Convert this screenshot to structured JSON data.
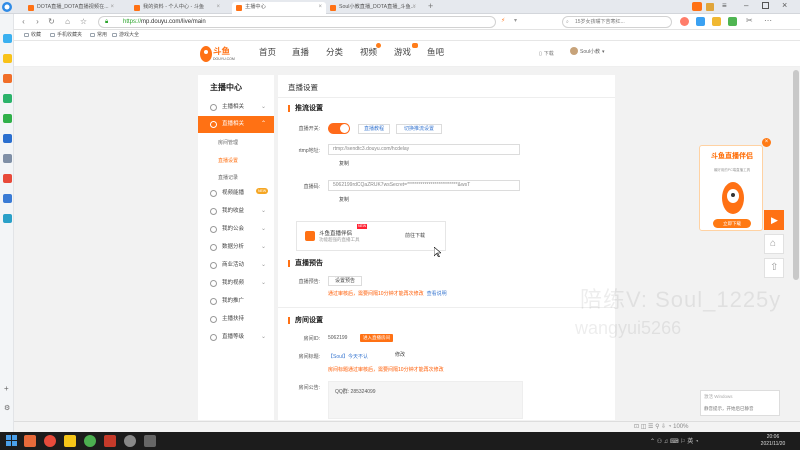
{
  "browser": {
    "tabs": [
      {
        "label": "DOTA直播_DOTA直播视频在..."
      },
      {
        "label": "我的资料 - 个人中心 - 斗鱼"
      },
      {
        "label": "主播中心"
      },
      {
        "label": "Soul小教直播_DOTA直播_斗鱼..."
      }
    ],
    "url_prefix": "https://",
    "url_rest": "mp.douyu.com/live/main",
    "search_placeholder": "15岁女孩嘴下苦寒红...",
    "bookmarks": [
      "收藏",
      "手机收藏夹",
      "常用",
      "游戏大全"
    ]
  },
  "site": {
    "logo_text": "斗鱼",
    "logo_sub": "DOUYU.COM",
    "nav": [
      "首页",
      "直播",
      "分类",
      "视频",
      "游戏",
      "鱼吧"
    ],
    "download": "下载",
    "user": "Soul小教"
  },
  "sidebar": {
    "title": "主播中心",
    "items": [
      {
        "label": "主播相关"
      },
      {
        "label": "直播相关"
      },
      {
        "label": "视频能播"
      },
      {
        "label": "我的收益"
      },
      {
        "label": "我的公会"
      },
      {
        "label": "数据分析"
      },
      {
        "label": "商业活动"
      },
      {
        "label": "我的视频"
      },
      {
        "label": "我的推广"
      },
      {
        "label": "主播扶持"
      },
      {
        "label": "直播等级"
      }
    ],
    "sub_items": [
      "房间管理",
      "直播设置",
      "直播记录"
    ]
  },
  "main": {
    "title": "直播设置",
    "push_section": "推流设置",
    "live_switch_label": "直播开关:",
    "live_tools_button": "直播教程",
    "switch_mode_button": "切换推流设置",
    "rtmp_label": "rtmp地址:",
    "rtmp_value": "rtmp://sendtc3.douyu.com/hcdelay",
    "copy_button_1": "复制",
    "stream_key_label": "直播码:",
    "stream_key_value": "5062199rdCQaZRUK7wsSecret=**************************&wsT",
    "copy_button_2": "复制",
    "promo_title": "斗鱼直播伴侣",
    "promo_sub": "功能超强的直播工具",
    "promo_new": "NEW",
    "promo_go": "前往下载",
    "preview_section": "直播预告",
    "preview_label": "直播预告:",
    "preview_button": "设置预告",
    "preview_note": "通过审核后，需要间隔10分钟才能再次修改",
    "preview_link": "查看说明",
    "room_section": "房间设置",
    "room_id_label": "房间ID:",
    "room_id_value": "5062199",
    "enter_room": "进入直播房间",
    "room_title_label": "房间标题:",
    "room_title_value": "【Soul】今天不认",
    "edit_button": "修改",
    "room_title_note": "房间标题通过审核后，需要间隔10分钟才能再次修改",
    "announce_label": "房间公告:",
    "announce_value": "QQ群: 285324099"
  },
  "float_card": {
    "title": "斗鱼直播伴侣",
    "sub": "最好用的PC端直播工具",
    "button": "立即下载"
  },
  "overlay": {
    "watermark_line1": "陪练V: Soul_1225y",
    "watermark_line2": "wangyui5266",
    "activate": "激活 Windows",
    "notif_text": "静音提示，开始后已静音"
  },
  "clock": {
    "time": "20:06",
    "date": "2021/11/20"
  },
  "colors": {
    "accent": "#ff7114",
    "link": "#3a78d1",
    "warn": "#ff5a00"
  }
}
